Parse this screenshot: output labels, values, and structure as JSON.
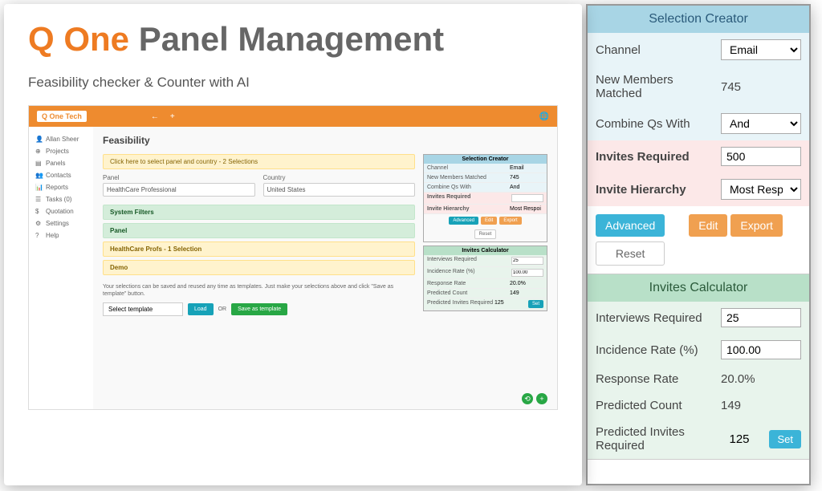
{
  "title": {
    "brand": "Q One",
    "rest": "Panel Management"
  },
  "subtitle": "Feasibility checker & Counter with AI",
  "app": {
    "logo": "Q One Tech",
    "user": "Allan Sheer",
    "sidebar": [
      {
        "icon": "👤",
        "label": "Allan Sheer"
      },
      {
        "icon": "⊕",
        "label": "Projects"
      },
      {
        "icon": "▤",
        "label": "Panels"
      },
      {
        "icon": "👥",
        "label": "Contacts"
      },
      {
        "icon": "📊",
        "label": "Reports"
      },
      {
        "icon": "☰",
        "label": "Tasks (0)"
      },
      {
        "icon": "$",
        "label": "Quotation"
      },
      {
        "icon": "⚙",
        "label": "Settings"
      },
      {
        "icon": "?",
        "label": "Help"
      }
    ],
    "main_title": "Feasibility",
    "banner": "Click here to select panel and country - 2 Selections",
    "panel_label": "Panel",
    "panel_value": "HealthCare Professional",
    "country_label": "Country",
    "country_value": "United States",
    "rows": [
      {
        "type": "green",
        "text": "System Filters"
      },
      {
        "type": "green",
        "text": "Panel"
      },
      {
        "type": "yellow",
        "text": "HealthCare Profs - 1 Selection"
      },
      {
        "type": "yellow",
        "text": "Demo"
      }
    ],
    "save_text": "Your selections can be saved and reused any time as templates. Just make your selections above and click \"Save as template\" button.",
    "template_select": "Select template",
    "load_btn": "Load",
    "or": "OR",
    "save_btn": "Save as template",
    "mini_sel": {
      "header": "Selection Creator",
      "channel_lbl": "Channel",
      "channel_val": "Email",
      "newmem_lbl": "New Members Matched",
      "newmem_val": "745",
      "combine_lbl": "Combine Qs With",
      "combine_val": "And",
      "invites_lbl": "Invites Required",
      "hierarchy_lbl": "Invite Hierarchy",
      "hierarchy_val": "Most Respoi",
      "adv": "Advanced",
      "edit": "Edit",
      "export": "Export",
      "reset": "Reset"
    },
    "mini_calc": {
      "header": "Invites Calculator",
      "interviews_lbl": "Interviews Required",
      "interviews_val": "25",
      "incidence_lbl": "Incidence Rate (%)",
      "incidence_val": "100.00",
      "response_lbl": "Response Rate",
      "response_val": "20.0%",
      "predcount_lbl": "Predicted Count",
      "predcount_val": "149",
      "predinvites_lbl": "Predicted Invites Required",
      "predinvites_val": "125",
      "set": "Set"
    }
  },
  "selcreator": {
    "header": "Selection Creator",
    "channel_lbl": "Channel",
    "channel_val": "Email",
    "newmem_lbl": "New Members Matched",
    "newmem_val": "745",
    "combine_lbl": "Combine Qs With",
    "combine_val": "And",
    "invites_lbl": "Invites Required",
    "invites_val": "500",
    "hierarchy_lbl": "Invite Hierarchy",
    "hierarchy_val": "Most Respoi",
    "adv_btn": "Advanced",
    "reset_btn": "Reset",
    "edit_btn": "Edit",
    "export_btn": "Export"
  },
  "calculator": {
    "header": "Invites Calculator",
    "interviews_lbl": "Interviews Required",
    "interviews_val": "25",
    "incidence_lbl": "Incidence Rate (%)",
    "incidence_val": "100.00",
    "response_lbl": "Response Rate",
    "response_val": "20.0%",
    "predcount_lbl": "Predicted Count",
    "predcount_val": "149",
    "predinvites_lbl": "Predicted Invites Required",
    "predinvites_val": "125",
    "set_btn": "Set"
  }
}
